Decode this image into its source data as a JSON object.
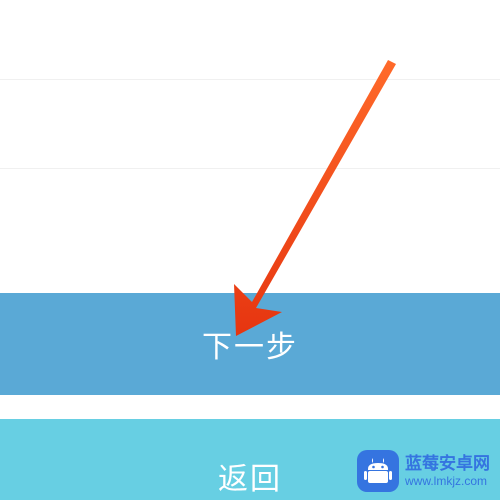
{
  "buttons": {
    "primary_label": "下一步",
    "secondary_label": "返回"
  },
  "watermark": {
    "title": "蓝莓安卓网",
    "url": "www.lmkjz.com"
  },
  "colors": {
    "primary_blue": "#5aa9d6",
    "secondary_teal": "#67cfe3",
    "arrow_red": "#ff4a1a",
    "brand_blue": "#3574e0"
  }
}
